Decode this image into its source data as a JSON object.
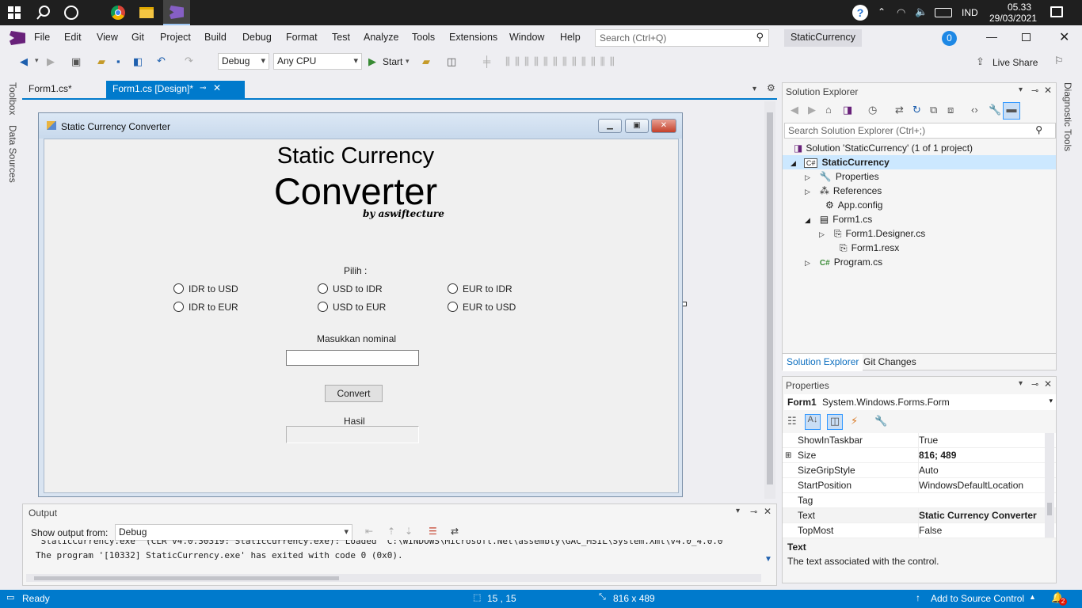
{
  "taskbar": {
    "time": "05.33",
    "date": "29/03/2021",
    "language": "IND"
  },
  "menu": {
    "items": [
      "File",
      "Edit",
      "View",
      "Git",
      "Project",
      "Build",
      "Debug",
      "Format",
      "Test",
      "Analyze",
      "Tools",
      "Extensions",
      "Window",
      "Help"
    ],
    "search_placeholder": "Search (Ctrl+Q)",
    "solution_name": "StaticCurrency",
    "notification_count": "0"
  },
  "toolbar": {
    "config": "Debug",
    "platform": "Any CPU",
    "start_label": "Start",
    "live_share": "Live Share"
  },
  "side_tabs": {
    "left": [
      "Toolbox",
      "Data Sources"
    ],
    "right": "Diagnostic Tools"
  },
  "doc_tabs": [
    {
      "label": "Form1.cs*"
    },
    {
      "label": "Form1.cs [Design]*"
    }
  ],
  "form": {
    "window_title": "Static Currency Converter",
    "heading_line1": "Static Currency",
    "heading_line2": "Converter",
    "byline": "by aswiftecture",
    "choose_label": "Pilih :",
    "radios": [
      {
        "label": "IDR to USD"
      },
      {
        "label": "USD to IDR"
      },
      {
        "label": "EUR to IDR"
      },
      {
        "label": "IDR to EUR"
      },
      {
        "label": "USD to EUR"
      },
      {
        "label": "EUR to USD"
      }
    ],
    "amount_label": "Masukkan nominal",
    "amount_value": "",
    "convert_button": "Convert",
    "result_label": "Hasil",
    "result_value": ""
  },
  "solution_explorer": {
    "title": "Solution Explorer",
    "search_placeholder": "Search Solution Explorer (Ctrl+;)",
    "tree": [
      {
        "label": "Solution 'StaticCurrency' (1 of 1 project)"
      },
      {
        "label": "StaticCurrency"
      },
      {
        "label": "Properties"
      },
      {
        "label": "References"
      },
      {
        "label": "App.config"
      },
      {
        "label": "Form1.cs"
      },
      {
        "label": "Form1.Designer.cs"
      },
      {
        "label": "Form1.resx"
      },
      {
        "label": "Program.cs"
      }
    ],
    "bottom_tabs": [
      "Solution Explorer",
      "Git Changes"
    ]
  },
  "properties": {
    "title": "Properties",
    "object_name": "Form1",
    "object_type": "System.Windows.Forms.Form",
    "rows": [
      {
        "key": "ShowInTaskbar",
        "value": "True"
      },
      {
        "key": "Size",
        "value": "816; 489"
      },
      {
        "key": "SizeGripStyle",
        "value": "Auto"
      },
      {
        "key": "StartPosition",
        "value": "WindowsDefaultLocation"
      },
      {
        "key": "Tag",
        "value": ""
      },
      {
        "key": "Text",
        "value": "Static Currency Converter"
      },
      {
        "key": "TopMost",
        "value": "False"
      }
    ],
    "desc_title": "Text",
    "desc_text": "The text associated with the control."
  },
  "output": {
    "title": "Output",
    "show_from_label": "Show output from:",
    "show_from_value": "Debug",
    "line1": "'StaticCurrency.exe' (CLR v4.0.30319: StaticCurrency.exe): Loaded 'C:\\WINDOWS\\Microsoft.Net\\assembly\\GAC_MSIL\\System.Xml\\v4.0_4.0.0",
    "line2": "The program '[10332] StaticCurrency.exe' has exited with code 0 (0x0)."
  },
  "status": {
    "ready": "Ready",
    "position": "15 , 15",
    "size": "816 x 489",
    "source_control": "Add to Source Control",
    "notif_count": "2"
  },
  "colors": {
    "accent": "#007acc",
    "vs_purple": "#68217a",
    "taskbar": "#1f1f1f"
  }
}
